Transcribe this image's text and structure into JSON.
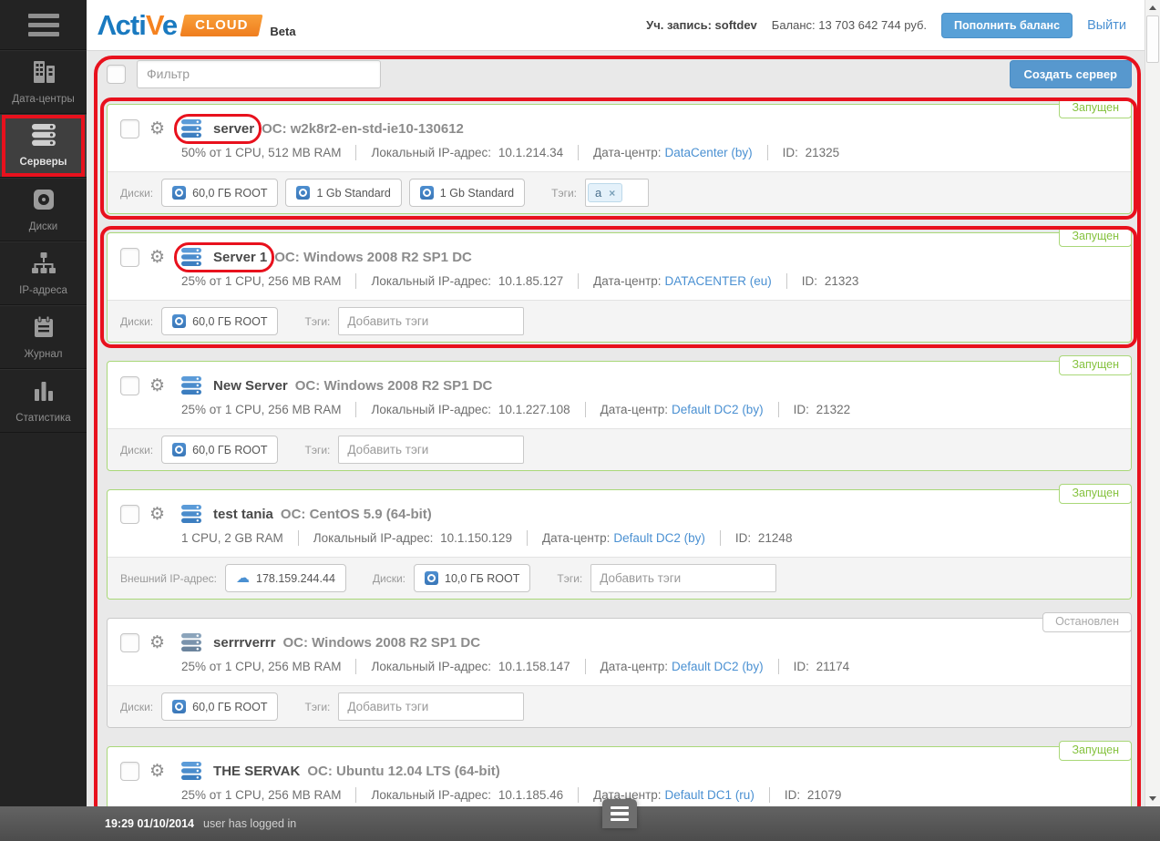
{
  "header": {
    "logo_part1": "Λcti",
    "logo_part2": "V",
    "logo_part3": "e",
    "logo_badge": "CLOUD",
    "logo_beta": "Beta",
    "account_label": "Уч. запись:",
    "account_value": "softdev",
    "balance_label": "Баланс:",
    "balance_value": "13 703 642 744 руб.",
    "topup_button": "Пополнить баланс",
    "logout_link": "Выйти"
  },
  "sidebar": {
    "items": [
      {
        "key": "datacenters",
        "label": "Дата-центры",
        "icon": "datacenters-icon",
        "active": false,
        "annotated": false
      },
      {
        "key": "servers",
        "label": "Серверы",
        "icon": "servers-icon",
        "active": true,
        "annotated": true
      },
      {
        "key": "disks",
        "label": "Диски",
        "icon": "disks-icon",
        "active": false,
        "annotated": false
      },
      {
        "key": "ip-addresses",
        "label": "IP-адреса",
        "icon": "ip-icon",
        "active": false,
        "annotated": false
      },
      {
        "key": "journal",
        "label": "Журнал",
        "icon": "journal-icon",
        "active": false,
        "annotated": false
      },
      {
        "key": "statistics",
        "label": "Статистика",
        "icon": "stats-icon",
        "active": false,
        "annotated": false
      }
    ]
  },
  "toolbar": {
    "filter_placeholder": "Фильтр",
    "create_button": "Создать сервер"
  },
  "labels": {
    "os_prefix": "ОС:",
    "local_ip": "Локальный IP-адрес:",
    "datacenter": "Дата-центр:",
    "id": "ID:",
    "disks": "Диски:",
    "tags": "Тэги:",
    "external_ip": "Внешний IP-адрес:",
    "tags_placeholder": "Добавить тэги"
  },
  "statuses": {
    "running": "Запущен",
    "stopped": "Остановлен"
  },
  "status_colors": {
    "running": "#85c23e",
    "stopped": "#a8a8a8"
  },
  "servers": [
    {
      "name": "server",
      "os": "w2k8r2-en-std-ie10-130612",
      "specs": "50% от 1 CPU, 512 MB RAM",
      "local_ip": "10.1.214.34",
      "datacenter": "DataCenter (by)",
      "id": "21325",
      "status": "running",
      "disks": [
        "60,0 ГБ ROOT",
        "1 Gb Standard",
        "1 Gb Standard"
      ],
      "tags": [
        "a"
      ],
      "external_ip": "",
      "annotated_name": true,
      "annotated_card": true,
      "cut_off": false
    },
    {
      "name": "Server 1",
      "os": "Windows 2008 R2 SP1 DC",
      "specs": "25% от 1 CPU, 256 MB RAM",
      "local_ip": "10.1.85.127",
      "datacenter": "DATACENTER (eu)",
      "id": "21323",
      "status": "running",
      "disks": [
        "60,0 ГБ ROOT"
      ],
      "tags": [],
      "external_ip": "",
      "annotated_name": true,
      "annotated_card": true,
      "cut_off": false
    },
    {
      "name": "New Server",
      "os": "Windows 2008 R2 SP1 DC",
      "specs": "25% от 1 CPU, 256 MB RAM",
      "local_ip": "10.1.227.108",
      "datacenter": "Default DC2 (by)",
      "id": "21322",
      "status": "running",
      "disks": [
        "60,0 ГБ ROOT"
      ],
      "tags": [],
      "external_ip": "",
      "annotated_name": false,
      "annotated_card": false,
      "cut_off": false
    },
    {
      "name": "test tania",
      "os": "CentOS 5.9 (64-bit)",
      "specs": "1 CPU, 2 GB RAM",
      "local_ip": "10.1.150.129",
      "datacenter": "Default DC2 (by)",
      "id": "21248",
      "status": "running",
      "disks": [
        "10,0 ГБ ROOT"
      ],
      "tags": [],
      "external_ip": "178.159.244.44",
      "annotated_name": false,
      "annotated_card": false,
      "cut_off": false
    },
    {
      "name": "serrrverrr",
      "os": "Windows 2008 R2 SP1 DC",
      "specs": "25% от 1 CPU, 256 MB RAM",
      "local_ip": "10.1.158.147",
      "datacenter": "Default DC2 (by)",
      "id": "21174",
      "status": "stopped",
      "disks": [
        "60,0 ГБ ROOT"
      ],
      "tags": [],
      "external_ip": "",
      "annotated_name": false,
      "annotated_card": false,
      "cut_off": false
    },
    {
      "name": "THE SERVAK",
      "os": "Ubuntu 12.04 LTS (64-bit)",
      "specs": "25% от 1 CPU, 256 MB RAM",
      "local_ip": "10.1.185.46",
      "datacenter": "Default DC1 (ru)",
      "id": "21079",
      "status": "running",
      "disks": [],
      "tags": [],
      "external_ip": "",
      "annotated_name": false,
      "annotated_card": false,
      "cut_off": true
    }
  ],
  "statusbar": {
    "timestamp": "19:29 01/10/2014",
    "message": "user has logged in"
  },
  "annotations": {
    "color": "#e8111d",
    "outer_box": true
  }
}
